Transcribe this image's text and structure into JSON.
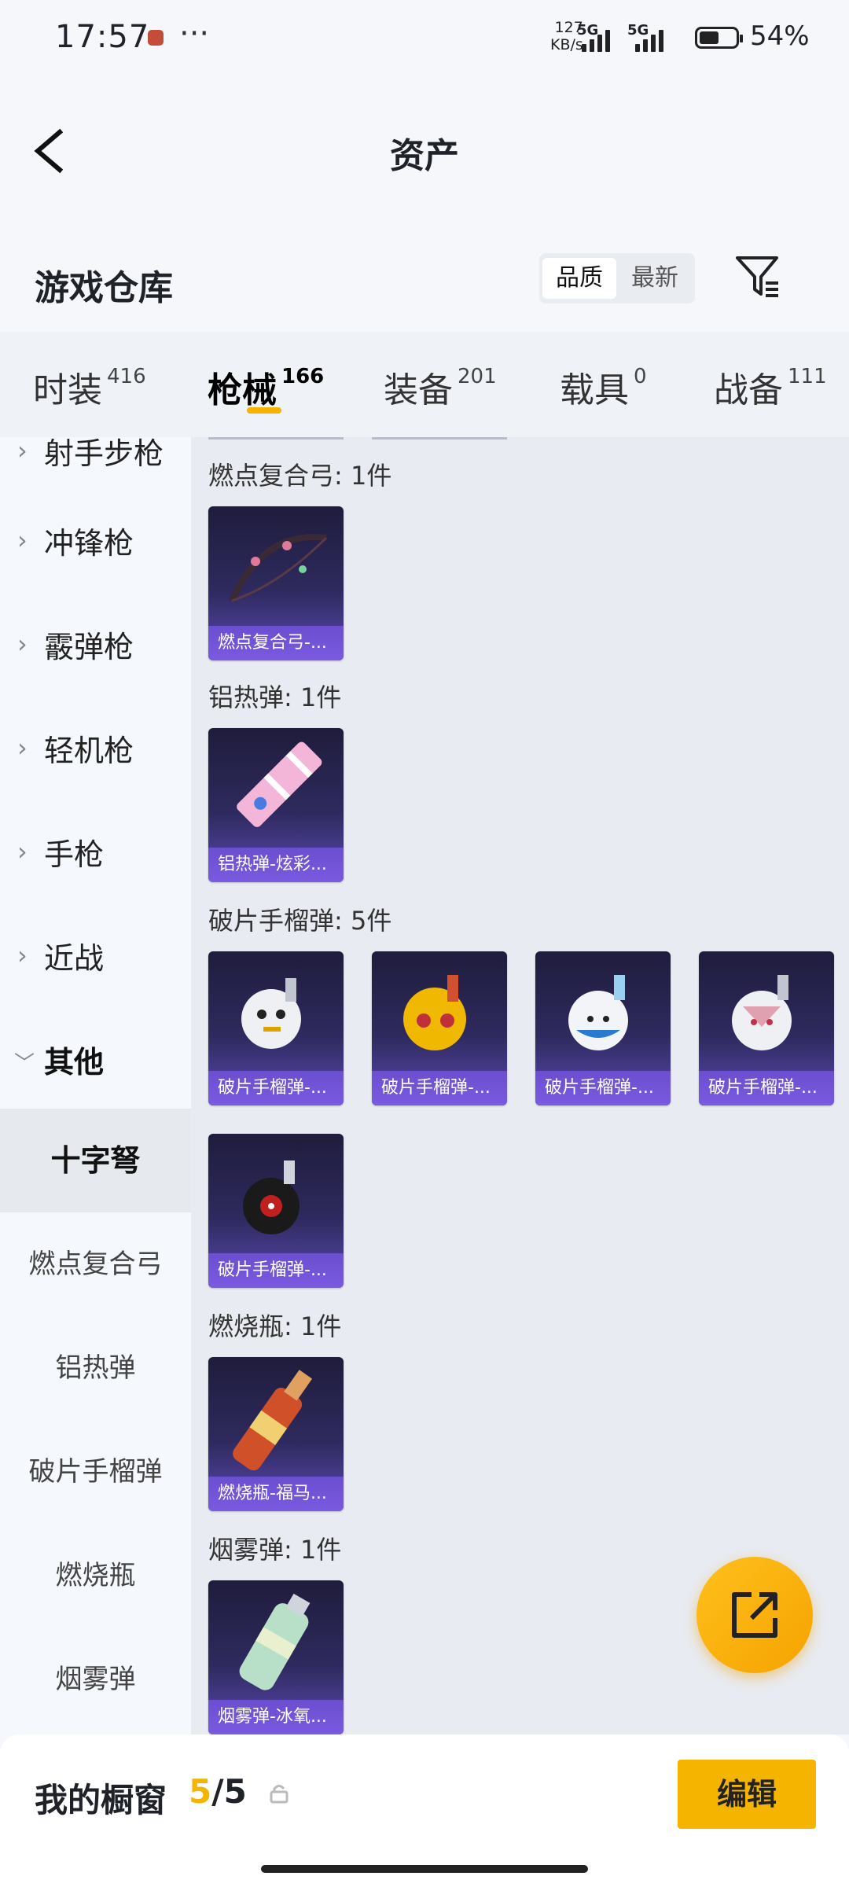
{
  "status_bar": {
    "time": "17:57",
    "net_speed_value": "127",
    "net_speed_unit": "KB/s",
    "signal1": "5G",
    "signal2": "5G",
    "battery": "54%"
  },
  "header": {
    "title": "资产"
  },
  "warehouse": {
    "title": "游戏仓库",
    "sort_quality": "品质",
    "sort_newest": "最新"
  },
  "tabs": [
    {
      "label": "时装",
      "count": "416"
    },
    {
      "label": "枪械",
      "count": "166"
    },
    {
      "label": "装备",
      "count": "201"
    },
    {
      "label": "载具",
      "count": "0"
    },
    {
      "label": "战备",
      "count": "111"
    }
  ],
  "sidebar": {
    "partial_top": "射手步枪",
    "categories": [
      "冲锋枪",
      "霰弹枪",
      "轻机枪",
      "手枪",
      "近战",
      "其他"
    ],
    "subitems": [
      "十字弩",
      "燃点复合弓",
      "铝热弹",
      "破片手榴弹",
      "燃烧瓶",
      "烟雾弹"
    ]
  },
  "groups": [
    {
      "title": "燃点复合弓: 1件",
      "items": [
        "燃点复合弓-..."
      ]
    },
    {
      "title": "铝热弹: 1件",
      "items": [
        "铝热弹-炫彩..."
      ]
    },
    {
      "title": "破片手榴弹: 5件",
      "items": [
        "破片手榴弹-...",
        "破片手榴弹-...",
        "破片手榴弹-...",
        "破片手榴弹-...",
        "破片手榴弹-..."
      ]
    },
    {
      "title": "燃烧瓶: 1件",
      "items": [
        "燃烧瓶-福马..."
      ]
    },
    {
      "title": "烟雾弹: 1件",
      "items": [
        "烟雾弹-冰氧..."
      ]
    }
  ],
  "bottom": {
    "title": "我的橱窗",
    "current": "5",
    "separator": "/",
    "total": "5",
    "edit": "编辑"
  },
  "colors": {
    "accent": "#f5b400",
    "card_purple": "#6a4fcf"
  },
  "icons": [
    "back-arrow-icon",
    "filter-icon",
    "chevron-right-icon",
    "chevron-down-icon",
    "share-icon",
    "lock-icon"
  ]
}
